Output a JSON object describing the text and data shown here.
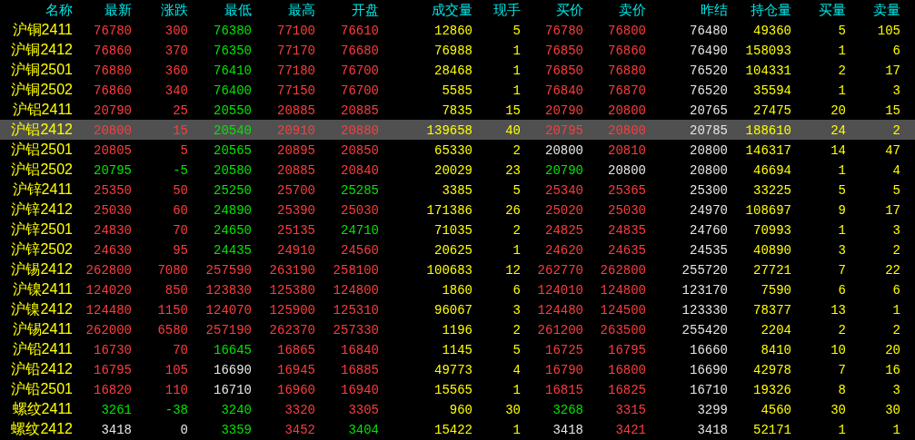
{
  "table": {
    "columns": [
      {
        "label": "名称",
        "kind": "name"
      },
      {
        "label": "最新",
        "kind": "price"
      },
      {
        "label": "涨跌",
        "kind": "change"
      },
      {
        "label": "最低",
        "kind": "price"
      },
      {
        "label": "最高",
        "kind": "price"
      },
      {
        "label": "开盘",
        "kind": "price"
      },
      {
        "label": "成交量",
        "kind": "qty"
      },
      {
        "label": "现手",
        "kind": "qty"
      },
      {
        "label": "买价",
        "kind": "price"
      },
      {
        "label": "卖价",
        "kind": "price"
      },
      {
        "label": "昨结",
        "kind": "prev"
      },
      {
        "label": "持仓量",
        "kind": "qty"
      },
      {
        "label": "买量",
        "kind": "qty"
      },
      {
        "label": "卖量",
        "kind": "qty"
      }
    ],
    "rows": [
      {
        "selected": false,
        "cells": [
          "沪铜2411",
          "76780",
          "300",
          "76380",
          "77100",
          "76610",
          "12860",
          "5",
          "76780",
          "76800",
          "76480",
          "49360",
          "5",
          "105"
        ]
      },
      {
        "selected": false,
        "cells": [
          "沪铜2412",
          "76860",
          "370",
          "76350",
          "77170",
          "76680",
          "76988",
          "1",
          "76850",
          "76860",
          "76490",
          "158093",
          "1",
          "6"
        ]
      },
      {
        "selected": false,
        "cells": [
          "沪铜2501",
          "76880",
          "360",
          "76410",
          "77180",
          "76700",
          "28468",
          "1",
          "76850",
          "76880",
          "76520",
          "104331",
          "2",
          "17"
        ]
      },
      {
        "selected": false,
        "cells": [
          "沪铜2502",
          "76860",
          "340",
          "76400",
          "77150",
          "76700",
          "5585",
          "1",
          "76840",
          "76870",
          "76520",
          "35594",
          "1",
          "3"
        ]
      },
      {
        "selected": false,
        "cells": [
          "沪铝2411",
          "20790",
          "25",
          "20550",
          "20885",
          "20885",
          "7835",
          "15",
          "20790",
          "20800",
          "20765",
          "27475",
          "20",
          "15"
        ]
      },
      {
        "selected": true,
        "cells": [
          "沪铝2412",
          "20800",
          "15",
          "20540",
          "20910",
          "20880",
          "139658",
          "40",
          "20795",
          "20800",
          "20785",
          "188610",
          "24",
          "2"
        ]
      },
      {
        "selected": false,
        "cells": [
          "沪铝2501",
          "20805",
          "5",
          "20565",
          "20895",
          "20850",
          "65330",
          "2",
          "20800",
          "20810",
          "20800",
          "146317",
          "14",
          "47"
        ]
      },
      {
        "selected": false,
        "cells": [
          "沪铝2502",
          "20795",
          "-5",
          "20580",
          "20885",
          "20840",
          "20029",
          "23",
          "20790",
          "20800",
          "20800",
          "46694",
          "1",
          "4"
        ]
      },
      {
        "selected": false,
        "cells": [
          "沪锌2411",
          "25350",
          "50",
          "25250",
          "25700",
          "25285",
          "3385",
          "5",
          "25340",
          "25365",
          "25300",
          "33225",
          "5",
          "5"
        ]
      },
      {
        "selected": false,
        "cells": [
          "沪锌2412",
          "25030",
          "60",
          "24890",
          "25390",
          "25030",
          "171386",
          "26",
          "25020",
          "25030",
          "24970",
          "108697",
          "9",
          "17"
        ]
      },
      {
        "selected": false,
        "cells": [
          "沪锌2501",
          "24830",
          "70",
          "24650",
          "25135",
          "24710",
          "71035",
          "2",
          "24825",
          "24835",
          "24760",
          "70993",
          "1",
          "3"
        ]
      },
      {
        "selected": false,
        "cells": [
          "沪锌2502",
          "24630",
          "95",
          "24435",
          "24910",
          "24560",
          "20625",
          "1",
          "24620",
          "24635",
          "24535",
          "40890",
          "3",
          "2"
        ]
      },
      {
        "selected": false,
        "cells": [
          "沪锡2412",
          "262800",
          "7080",
          "257590",
          "263190",
          "258100",
          "100683",
          "12",
          "262770",
          "262800",
          "255720",
          "27721",
          "7",
          "22"
        ]
      },
      {
        "selected": false,
        "cells": [
          "沪镍2411",
          "124020",
          "850",
          "123830",
          "125380",
          "124800",
          "1860",
          "6",
          "124010",
          "124800",
          "123170",
          "7590",
          "6",
          "6"
        ]
      },
      {
        "selected": false,
        "cells": [
          "沪镍2412",
          "124480",
          "1150",
          "124070",
          "125900",
          "125310",
          "96067",
          "3",
          "124480",
          "124500",
          "123330",
          "78377",
          "13",
          "1"
        ]
      },
      {
        "selected": false,
        "cells": [
          "沪锡2411",
          "262000",
          "6580",
          "257190",
          "262370",
          "257330",
          "1196",
          "2",
          "261200",
          "263500",
          "255420",
          "2204",
          "2",
          "2"
        ]
      },
      {
        "selected": false,
        "cells": [
          "沪铅2411",
          "16730",
          "70",
          "16645",
          "16865",
          "16840",
          "1145",
          "5",
          "16725",
          "16795",
          "16660",
          "8410",
          "10",
          "20"
        ]
      },
      {
        "selected": false,
        "cells": [
          "沪铅2412",
          "16795",
          "105",
          "16690",
          "16945",
          "16885",
          "49773",
          "4",
          "16790",
          "16800",
          "16690",
          "42978",
          "7",
          "16"
        ]
      },
      {
        "selected": false,
        "cells": [
          "沪铅2501",
          "16820",
          "110",
          "16710",
          "16960",
          "16940",
          "15565",
          "1",
          "16815",
          "16825",
          "16710",
          "19326",
          "8",
          "3"
        ]
      },
      {
        "selected": false,
        "cells": [
          "螺纹2411",
          "3261",
          "-38",
          "3240",
          "3320",
          "3305",
          "960",
          "30",
          "3268",
          "3315",
          "3299",
          "4560",
          "30",
          "30"
        ]
      },
      {
        "selected": false,
        "cells": [
          "螺纹2412",
          "3418",
          "0",
          "3359",
          "3452",
          "3404",
          "15422",
          "1",
          "3418",
          "3421",
          "3418",
          "52171",
          "1",
          "1"
        ]
      }
    ]
  }
}
